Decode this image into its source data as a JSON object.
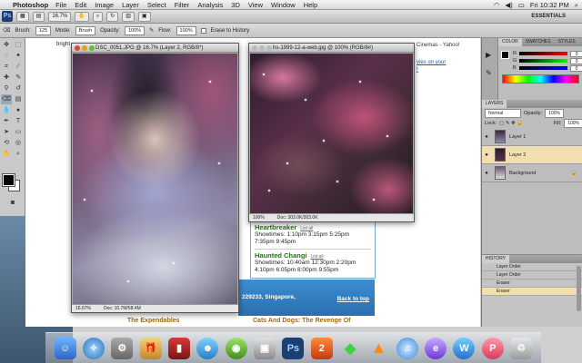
{
  "menubar": {
    "app_name": "Photoshop",
    "items": [
      "File",
      "Edit",
      "Image",
      "Layer",
      "Select",
      "Filter",
      "Analysis",
      "3D",
      "View",
      "Window",
      "Help"
    ],
    "clock": "Fri 10:32 PM"
  },
  "appbar": {
    "logo": "Ps",
    "zoom": "16.7%",
    "workspace": "ESSENTIALS"
  },
  "options": {
    "brush_label": "Brush:",
    "brush_size": "125",
    "mode_label": "Mode:",
    "mode_value": "Brush",
    "opacity_label": "Opacity:",
    "opacity_value": "100%",
    "flow_label": "Flow:",
    "flow_value": "100%",
    "erase_history": "Erase to History"
  },
  "browser": {
    "partial_left": "bright",
    "tab_title": "Cinemas - Yahoo!",
    "link_1": "vies on your",
    "link_2": "!",
    "showtimes": [
      {
        "title": "Heartbreaker",
        "list": "List all",
        "lines": [
          "Showtimes: 1:10pm 3:15pm 5:25pm",
          "7:35pm 9:45pm"
        ]
      },
      {
        "title": "Haunted Changi",
        "list": "List all",
        "lines": [
          "Showtimes: 10:40am 12:30pm 2:20pm",
          "4:10pm 6:05pm 8:00pm 9:55pm"
        ]
      }
    ],
    "address": "229233, Singapore,",
    "back_to_top": "Back to top",
    "expendables": "The Expendables",
    "cats_dogs": "Cats And Dogs: The Revenge Of"
  },
  "doc1": {
    "title": "DSC_0051.JPG @ 16.7% (Layer 2, RGB/8*)",
    "zoom": "16.67%",
    "info": "Doc: 10.7M/58.4M"
  },
  "doc2": {
    "title": "hs-1999-12-a-web.jpg @ 100% (RGB/8#)",
    "zoom": "100%",
    "info": "Doc: 303.0K/303.0K"
  },
  "color_panel": {
    "tabs": [
      "COLOR",
      "SWATCHES",
      "STYLES"
    ],
    "r": "R",
    "g": "G",
    "b": "B",
    "r_val": "0",
    "g_val": "0",
    "b_val": "0"
  },
  "layers_panel": {
    "tab": "LAYERS",
    "blend": "Normal",
    "opacity_label": "Opacity:",
    "opacity_value": "100%",
    "lock_label": "Lock:",
    "fill_label": "Fill:",
    "fill_value": "100%",
    "layers": [
      {
        "name": "Layer 1",
        "selected": false
      },
      {
        "name": "Layer 2",
        "selected": true
      },
      {
        "name": "Background",
        "selected": false
      }
    ]
  },
  "history_panel": {
    "tab": "HISTORY",
    "items": [
      {
        "name": "Layer Order",
        "selected": false
      },
      {
        "name": "Layer Order",
        "selected": false
      },
      {
        "name": "Eraser",
        "selected": false
      },
      {
        "name": "Eraser",
        "selected": true
      }
    ]
  },
  "dock": {
    "icons": [
      "finder-icon",
      "safari-icon",
      "system-prefs-icon",
      "gift-icon",
      "theater-icon",
      "messenger-icon",
      "mail-icon",
      "photo-icon",
      "photoshop-icon",
      "game-icon",
      "sims-icon",
      "vlc-icon",
      "itunes-icon",
      "blog-icon",
      "wordpress-icon",
      "badge-icon",
      "trash-icon"
    ],
    "ps_label": "Ps"
  },
  "colors": {
    "layer_selected": "#f2dfb0",
    "showtime_title": "#2a6d1a",
    "blue_band": "#2a6fb0"
  }
}
